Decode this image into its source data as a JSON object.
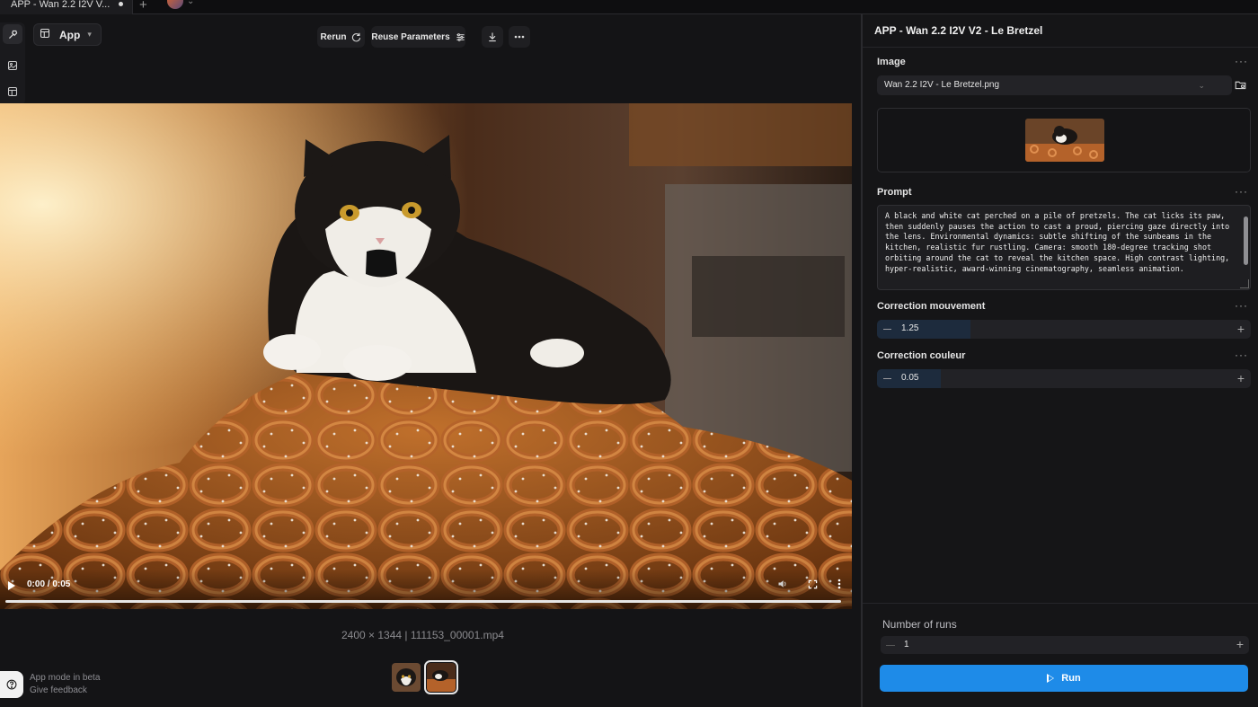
{
  "tab": {
    "title": "APP - Wan 2.2 I2V V..."
  },
  "toolbar": {
    "mode_label": "App",
    "rerun_label": "Rerun",
    "reuse_label": "Reuse Parameters"
  },
  "viewer": {
    "time": "0:00 / 0:05",
    "progress": 0,
    "meta": "2400 × 1344 | 111153_00001.mp4"
  },
  "footer": {
    "beta": "App mode in beta",
    "feedback": "Give feedback"
  },
  "panel": {
    "title": "APP - Wan 2.2 I2V V2 - Le Bretzel",
    "image": {
      "label": "Image",
      "file": "Wan 2.2 I2V - Le Bretzel.png"
    },
    "prompt": {
      "label": "Prompt",
      "text": "A black and white cat perched on a pile of pretzels. The cat licks its paw, then suddenly pauses the action to cast a proud, piercing gaze directly into the lens. Environmental dynamics: subtle shifting of the sunbeams in the kitchen, realistic fur rustling. Camera: smooth 180-degree tracking shot orbiting around the cat to reveal the kitchen space. High contrast lighting, hyper-realistic, award-winning cinematography, seamless animation."
    },
    "motion": {
      "label": "Correction mouvement",
      "value": "1.25"
    },
    "color": {
      "label": "Correction couleur",
      "value": "0.05"
    },
    "runs": {
      "label": "Number of runs",
      "value": "1"
    },
    "run_label": "Run"
  },
  "icons": {
    "rail": [
      "hammer-icon",
      "image-icon",
      "layout-icon"
    ],
    "toolbar": [
      "layout-icon",
      "chevron-down-icon",
      "refresh-icon",
      "sliders-icon",
      "download-icon",
      "more-icon"
    ],
    "video": [
      "play-icon",
      "volume-icon",
      "fullscreen-icon",
      "more-icon"
    ],
    "panel": [
      "more-icon",
      "chevron-down-icon",
      "folder-icon",
      "minus-icon",
      "plus-icon",
      "play-icon",
      "help-icon"
    ]
  },
  "colors": {
    "accent": "#1e8be8",
    "background": "#141416",
    "panel": "#151517",
    "stepper_fill": "#1d2b3d"
  }
}
